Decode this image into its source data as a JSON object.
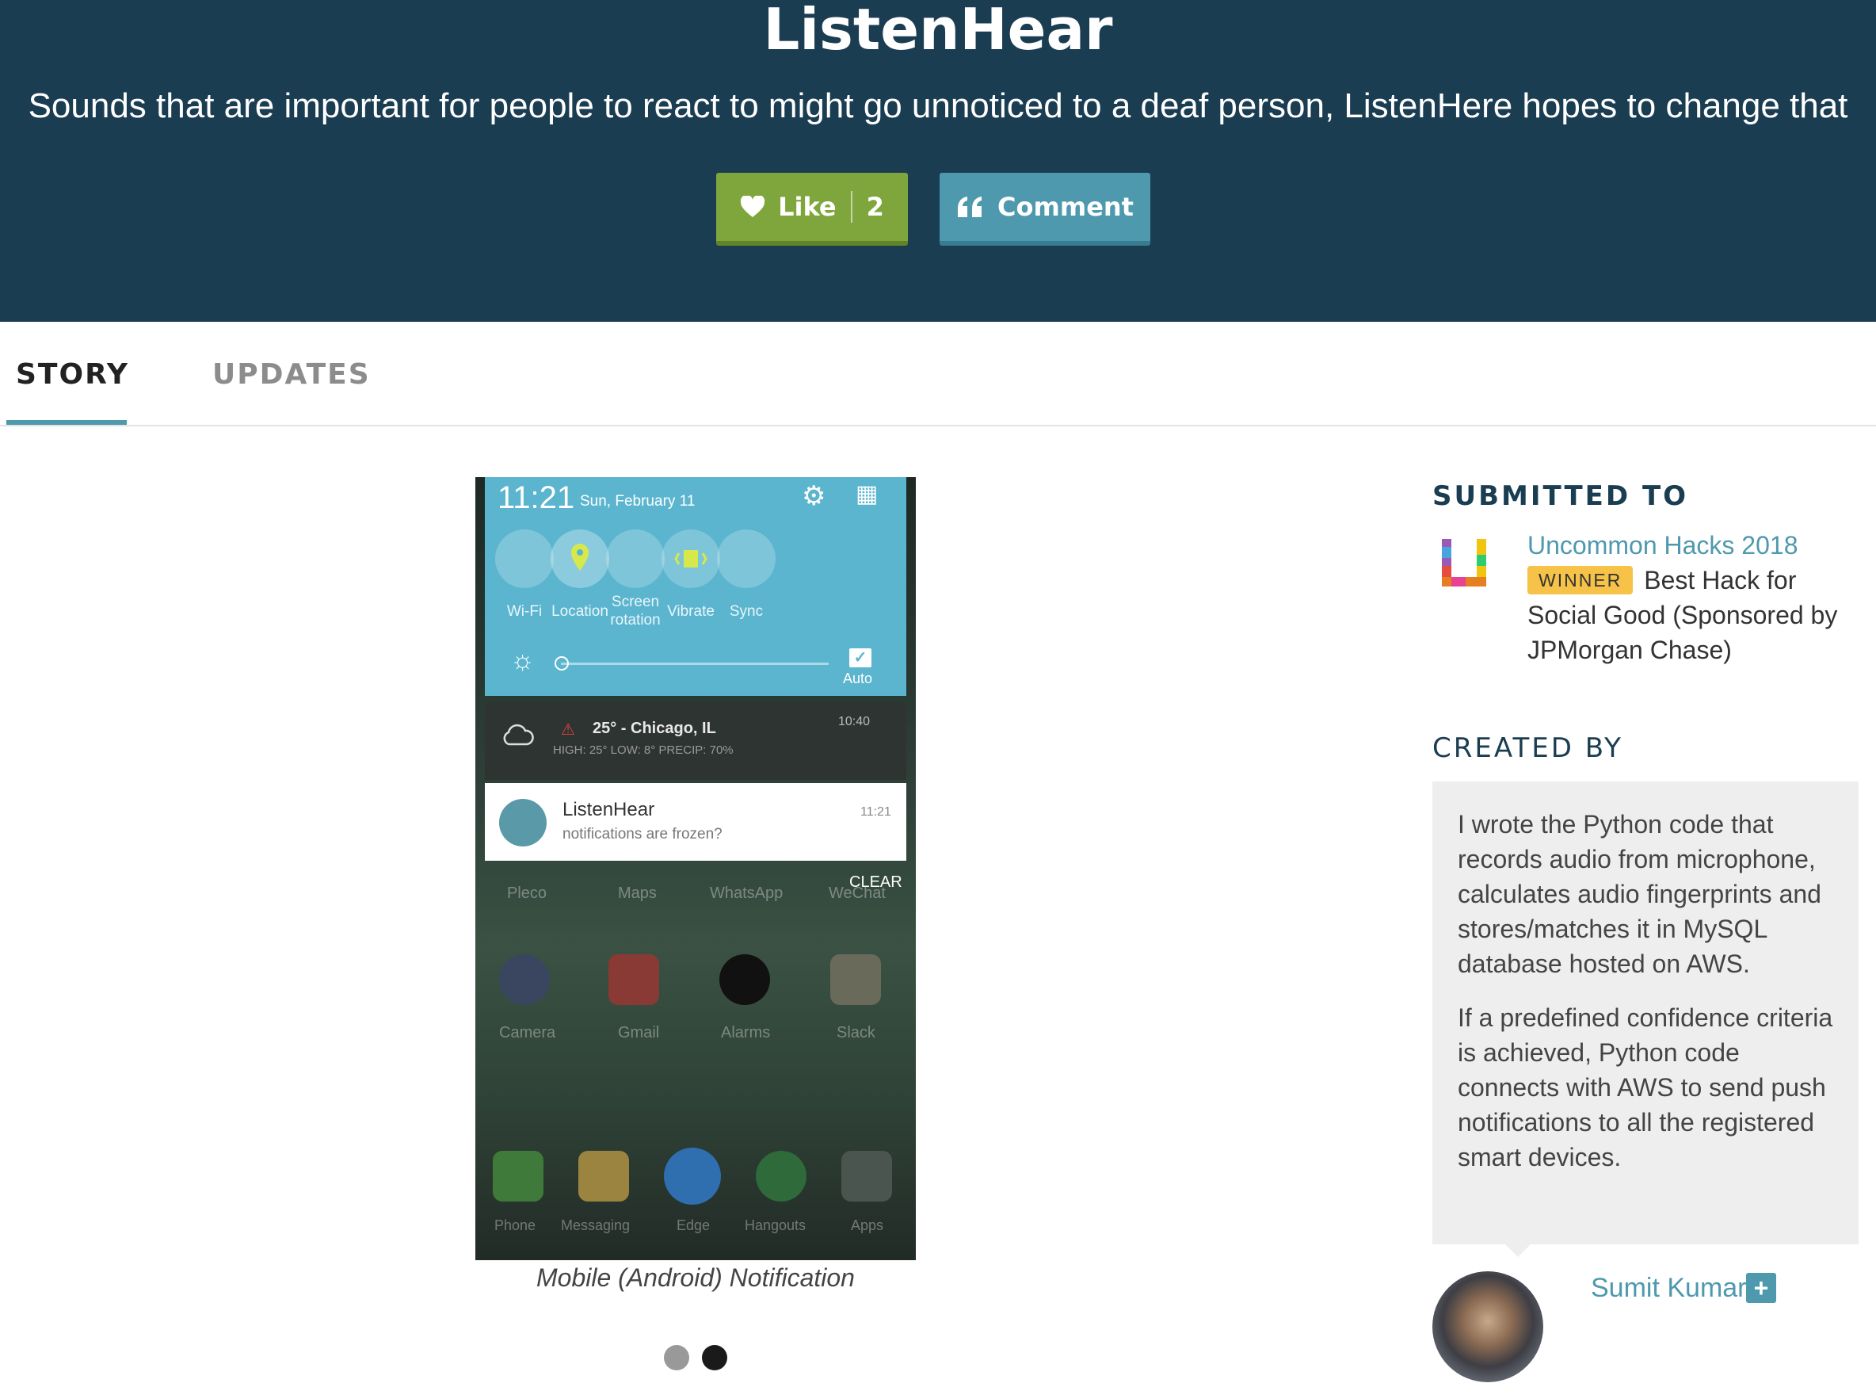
{
  "project": {
    "title": "ListenHear",
    "tagline": "Sounds that are important for people to react to might go unnoticed to a deaf person, ListenHere hopes to change that"
  },
  "actions": {
    "like_label": "Like",
    "like_count": "2",
    "comment_label": "Comment",
    "like_color": "#7ea63c",
    "comment_color": "#4e99ae"
  },
  "tabs": [
    {
      "label": "STORY",
      "active": true
    },
    {
      "label": "UPDATES",
      "active": false
    }
  ],
  "gallery": {
    "caption": "Mobile (Android) Notification",
    "slide_count": 2,
    "active_slide": 2,
    "screenshot": {
      "time": "11:21",
      "date": "Sun, February 11",
      "quick_settings": [
        {
          "label": "Wi-Fi",
          "icon": "wifi-icon"
        },
        {
          "label": "Location",
          "icon": "location-icon"
        },
        {
          "label": "Screen\nrotation",
          "icon": "rotation-icon"
        },
        {
          "label": "Vibrate",
          "icon": "vibrate-icon"
        },
        {
          "label": "Sync",
          "icon": "sync-icon"
        }
      ],
      "brightness_auto": "Auto",
      "weather": {
        "summary": "25° - Chicago, IL",
        "detail": "HIGH: 25° LOW: 8° PRECIP: 70%",
        "time": "10:40"
      },
      "notification": {
        "app": "ListenHear",
        "text": "notifications are frozen?",
        "time": "11:21"
      },
      "clear_label": "CLEAR",
      "apps_row1": [
        "Pleco",
        "Maps",
        "WhatsApp",
        "WeChat"
      ],
      "apps_row2": [
        "Camera",
        "Gmail",
        "Alarms",
        "Slack"
      ],
      "apps_dock": [
        "Phone",
        "Messaging",
        "Edge",
        "Hangouts",
        "Apps"
      ]
    }
  },
  "sidebar": {
    "submitted_heading": "SUBMITTED TO",
    "hackathon_name": "Uncommon Hacks 2018",
    "winner_badge": "WINNER",
    "prize": "Best Hack for Social Good (Sponsored by JPMorgan Chase)",
    "created_heading": "CREATED BY",
    "contribution": [
      "I wrote the Python code that records audio from microphone, calculates audio fingerprints and stores/matches it in MySQL database hosted on AWS.",
      "If a predefined confidence criteria is achieved, Python code connects with AWS to send push notifications to all the registered smart devices."
    ],
    "author_name": "Sumit Kumar",
    "follow_label": "+"
  }
}
